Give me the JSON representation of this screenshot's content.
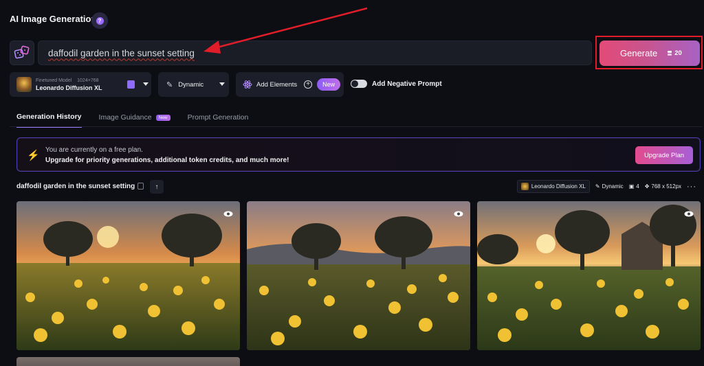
{
  "header": {
    "title": "AI Image Generation",
    "help_icon": "question-icon"
  },
  "prompt": {
    "value": "daffodil garden in the sunset setting",
    "dice_icon": "dice-icon"
  },
  "generate": {
    "label": "Generate",
    "token_count": "20",
    "token_icon": "token-icon"
  },
  "model": {
    "caption": "Finetuned Model",
    "dimensions": "1024×768",
    "name": "Leonardo Diffusion XL"
  },
  "style": {
    "label": "Dynamic"
  },
  "elements": {
    "label": "Add Elements",
    "new_badge": "New"
  },
  "negative_prompt": {
    "label": "Add Negative Prompt",
    "enabled": false
  },
  "tabs": [
    {
      "label": "Generation History",
      "active": true
    },
    {
      "label": "Image Guidance",
      "badge": "New"
    },
    {
      "label": "Prompt Generation"
    }
  ],
  "banner": {
    "line1": "You are currently on a free plan.",
    "line2": "Upgrade for priority generations, additional token credits, and much more!",
    "button": "Upgrade Plan"
  },
  "generation": {
    "prompt": "daffodil garden in the sunset setting",
    "model": "Leonardo Diffusion XL",
    "style": "Dynamic",
    "count": "4",
    "size": "768 x 512px"
  },
  "colors": {
    "accent": "#9b7bff",
    "generate_start": "#e34b78",
    "generate_end": "#a862c4",
    "annotation_red": "#e11d2a"
  }
}
